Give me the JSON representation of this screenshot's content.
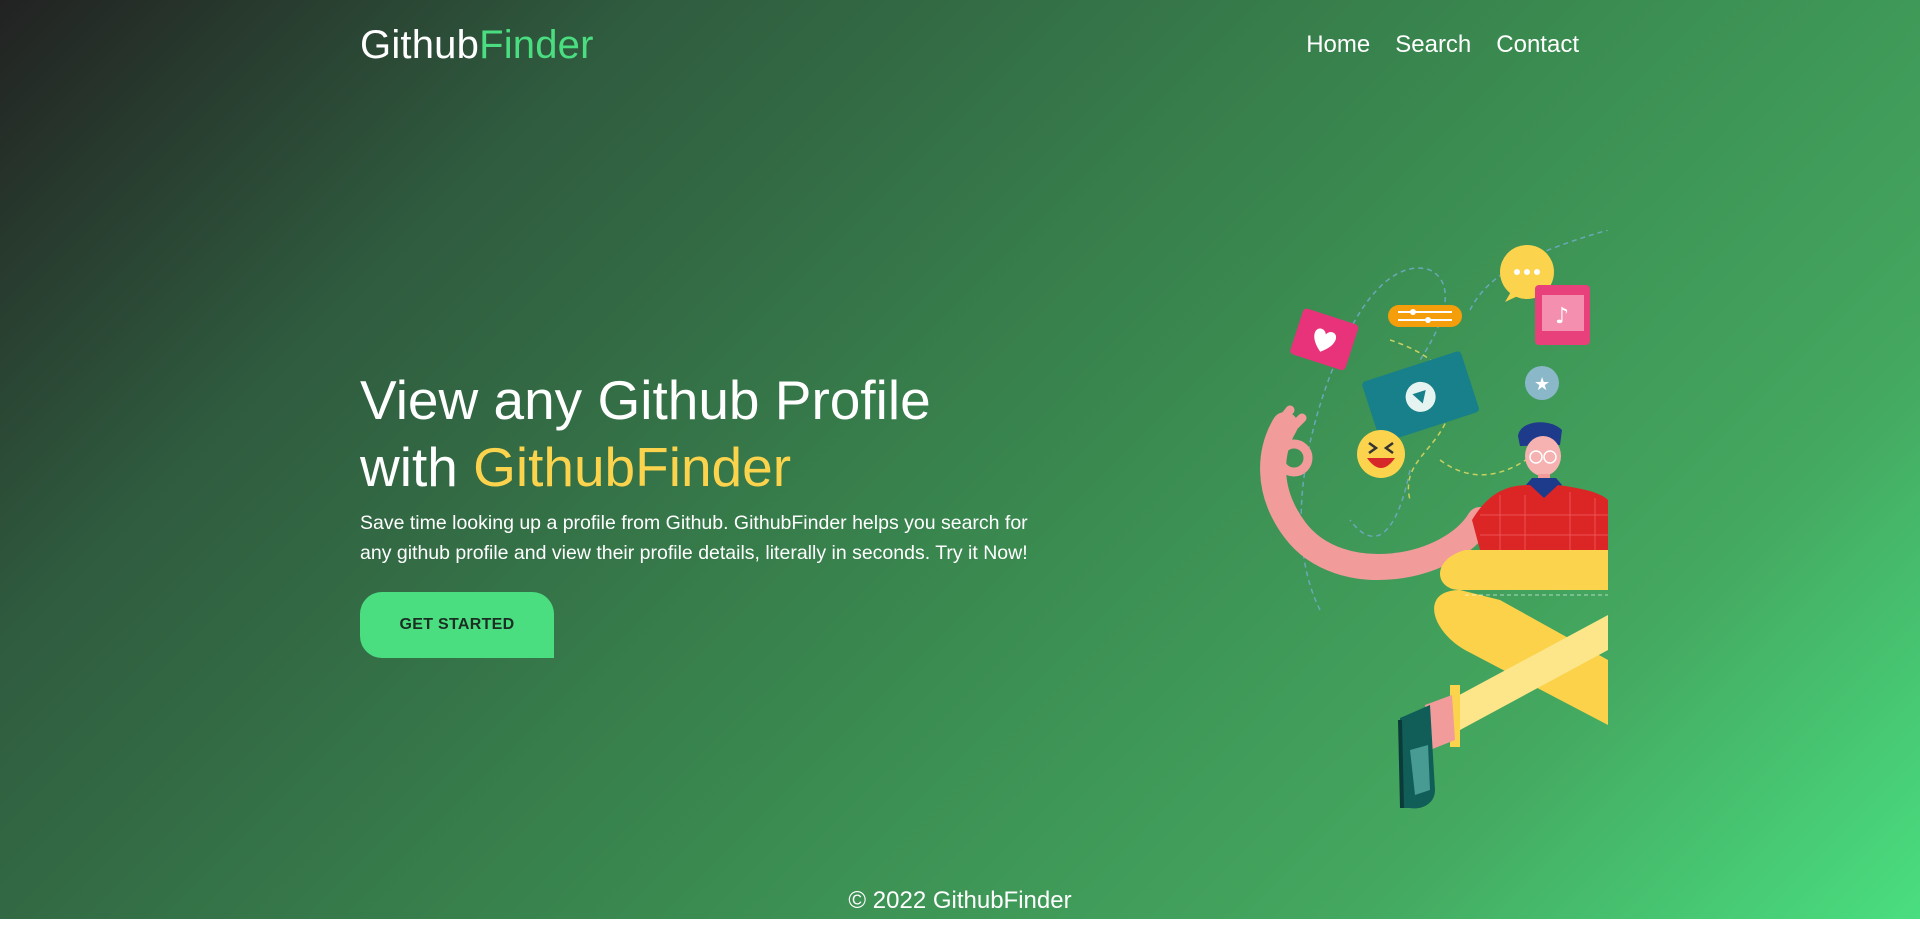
{
  "brand": {
    "logo_part1": "Github",
    "logo_part2": "Finder"
  },
  "nav": {
    "items": [
      {
        "label": "Home"
      },
      {
        "label": "Search"
      },
      {
        "label": "Contact"
      }
    ]
  },
  "hero": {
    "title_line1": "View any Github Profile",
    "title_line2_prefix": "with ",
    "title_line2_accent": "GithubFinder",
    "description": "Save time looking up a profile from Github. GithubFinder helps you search for any github profile and view their profile details, literally in seconds. Try it Now!",
    "cta_label": "GET STARTED"
  },
  "footer": {
    "copyright": "© 2022 GithubFinder"
  },
  "colors": {
    "accent_green": "#4ade80",
    "accent_yellow": "#fcd34d",
    "gradient_start": "#222222",
    "gradient_end": "#4ade80"
  },
  "illustration": {
    "name": "social-media-person-illustration"
  }
}
